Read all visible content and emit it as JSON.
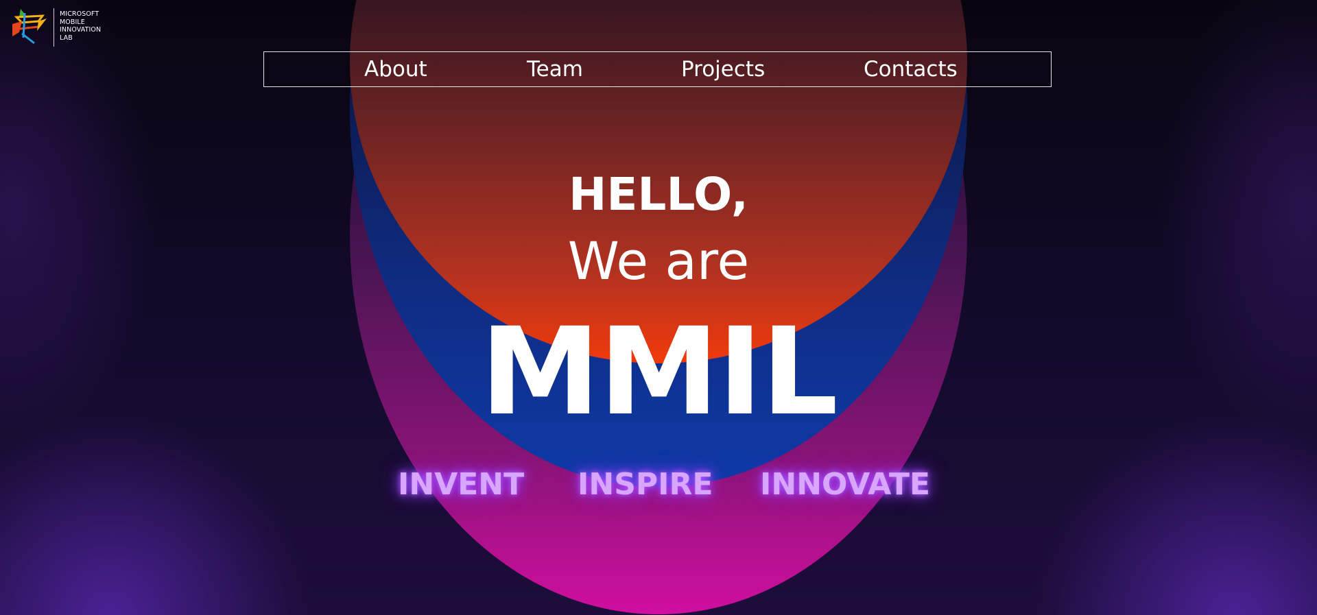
{
  "logo": {
    "lines": [
      "MICROSOFT",
      "MOBILE",
      "INNOVATION",
      "LAB"
    ]
  },
  "nav": {
    "items": [
      {
        "label": "About"
      },
      {
        "label": "Team"
      },
      {
        "label": "Projects"
      },
      {
        "label": "Contacts"
      }
    ]
  },
  "hero": {
    "greeting": "HELLO,",
    "intro": "We are",
    "name": "MMIL",
    "taglines": [
      "INVENT",
      "INSPIRE",
      "INNOVATE"
    ]
  },
  "colors": {
    "background": "#0b0619",
    "arc_red_bottom": "#f13a0a",
    "arc_blue_bottom": "#0e3aa8",
    "arc_pink_bottom": "#d10ea0",
    "tagline": "#d9a6ff",
    "tagline_glow": "#b45cff",
    "text": "#ffffff"
  }
}
